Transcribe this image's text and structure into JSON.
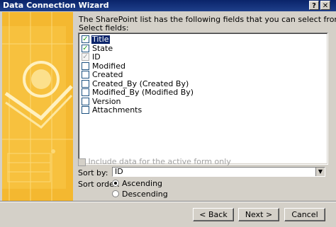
{
  "window": {
    "title": "Data Connection Wizard",
    "help_glyph": "?",
    "close_glyph": "✕"
  },
  "content": {
    "intro": "The SharePoint list has the following fields that you can select from.",
    "fields_label": "Select fields:",
    "fields": [
      {
        "label": "Title",
        "checked": true,
        "selected": true,
        "disabled": false
      },
      {
        "label": "State",
        "checked": true,
        "selected": false,
        "disabled": false
      },
      {
        "label": "ID",
        "checked": true,
        "selected": false,
        "disabled": true
      },
      {
        "label": "Modified",
        "checked": false,
        "selected": false,
        "disabled": false
      },
      {
        "label": "Created",
        "checked": false,
        "selected": false,
        "disabled": false
      },
      {
        "label": "Created_By (Created By)",
        "checked": false,
        "selected": false,
        "disabled": false
      },
      {
        "label": "Modified_By (Modified By)",
        "checked": false,
        "selected": false,
        "disabled": false
      },
      {
        "label": "Version",
        "checked": false,
        "selected": false,
        "disabled": false
      },
      {
        "label": "Attachments",
        "checked": false,
        "selected": false,
        "disabled": false
      }
    ],
    "include_label": "Include data for the active form only",
    "sort_by_label": "Sort by:",
    "sort_by_value": "ID",
    "sort_order_label": "Sort order:",
    "sort_options": [
      {
        "label": "Ascending",
        "selected": true
      },
      {
        "label": "Descending",
        "selected": false
      }
    ]
  },
  "buttons": {
    "back": "< Back",
    "next": "Next >",
    "cancel": "Cancel"
  },
  "colors": {
    "titlebar": "#0a246a",
    "dialog_bg": "#d4d0c8",
    "art_bg": "#f4b830",
    "selection": "#0a246a",
    "check": "#21a121"
  }
}
